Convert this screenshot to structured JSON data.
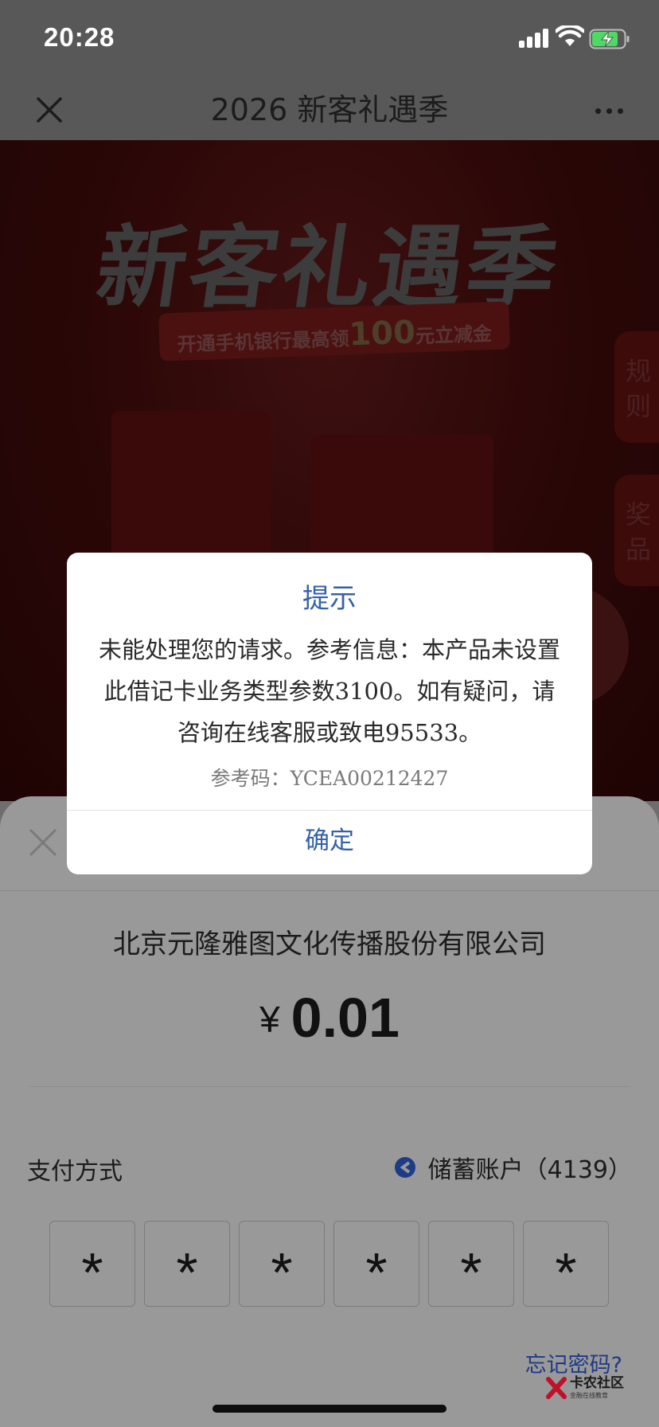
{
  "status_bar": {
    "time": "20:28"
  },
  "nav": {
    "title": "2026 新客礼遇季"
  },
  "banner": {
    "title": "新客礼遇季",
    "subtitle_pre": "开通手机银行最高领",
    "subtitle_amount": "100",
    "subtitle_post": "元立减金",
    "side_tab_rules": "规则",
    "side_tab_prizes": "奖品"
  },
  "dialog": {
    "title": "提示",
    "message": "未能处理您的请求。参考信息：本产品未设置此借记卡业务类型参数3100。如有疑问，请咨询在线客服或致电95533。",
    "reference": "参考码：YCEA00212427",
    "ok_label": "确定"
  },
  "payment": {
    "merchant": "北京元隆雅图文化传播股份有限公司",
    "currency_symbol": "¥",
    "amount": "0.01",
    "method_label": "支付方式",
    "account": "储蓄账户（4139）",
    "pin_digits": [
      "*",
      "*",
      "*",
      "*",
      "*",
      "*"
    ],
    "forgot_password": "忘记密码?"
  },
  "watermark": {
    "name": "卡农社区",
    "tagline": "金融在线教育"
  },
  "colors": {
    "accent_blue": "#3561a8",
    "link_blue": "#1f3a86",
    "overlay": "#999999",
    "banner_red": "#2b0707"
  }
}
